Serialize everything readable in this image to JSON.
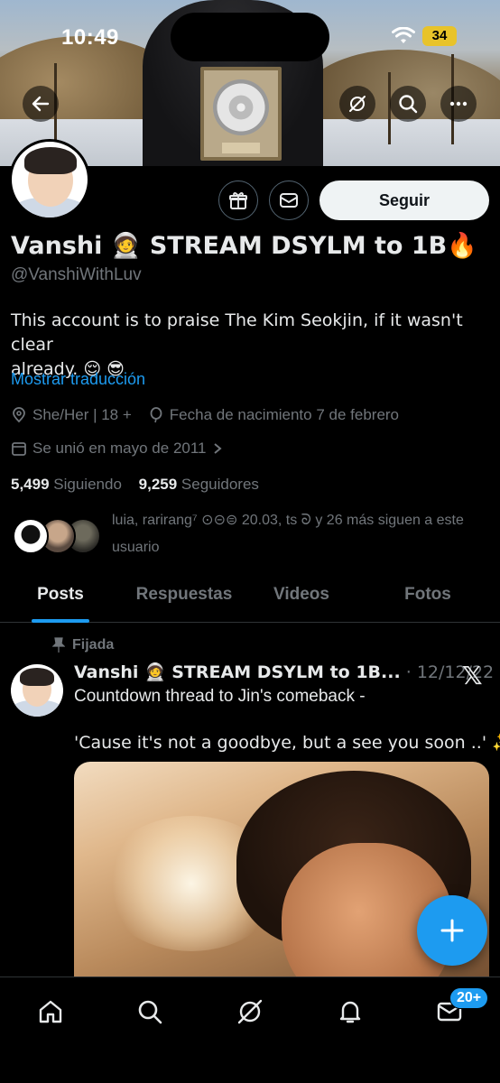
{
  "status_bar": {
    "time": "10:49",
    "battery": "34"
  },
  "profile": {
    "display_name": "Vanshi 🧑‍🚀 STREAM DSYLM to 1B🔥",
    "handle": "@VanshiWithLuv",
    "bio_line1": "This account is to praise The Kim Seokjin, if it wasn't clear",
    "bio_line2": "already. 😌 😎",
    "translate_label": "Mostrar traducción",
    "pronouns": "She/Her | 18 +",
    "birthday": "Fecha de nacimiento 7 de febrero",
    "joined": "Se unió en mayo de 2011",
    "following_count": "5,499",
    "following_label": "Siguiendo",
    "followers_count": "9,259",
    "followers_label": "Seguidores",
    "known_followers_line1": "luia, rarirang⁷ ⊙⊝⊜ 20.03, ts ᘐ y 26 más siguen a este",
    "known_followers_line2": "usuario",
    "follow_button": "Seguir"
  },
  "tabs": [
    "Posts",
    "Respuestas",
    "Videos",
    "Fotos"
  ],
  "post": {
    "pinned_label": "Fijada",
    "author": "Vanshi 🧑‍🚀 STREAM DSYLM to 1B...",
    "date": "· 12/12/22",
    "line1": "Countdown thread to Jin's comeback -",
    "line2": "'Cause it's not a goodbye, but a see you soon ..' ✨"
  },
  "bottom_nav": {
    "messages_badge": "20+"
  },
  "colors": {
    "accent": "#1d9bf0",
    "background": "#000000",
    "muted": "#71767b"
  },
  "icons": [
    "back-arrow-icon",
    "grok-icon",
    "search-icon",
    "more-icon",
    "gift-icon",
    "message-icon",
    "location-icon",
    "balloon-icon",
    "calendar-icon",
    "pin-icon",
    "x-logo-icon",
    "plus-icon",
    "home-icon",
    "bell-icon",
    "mail-icon"
  ]
}
